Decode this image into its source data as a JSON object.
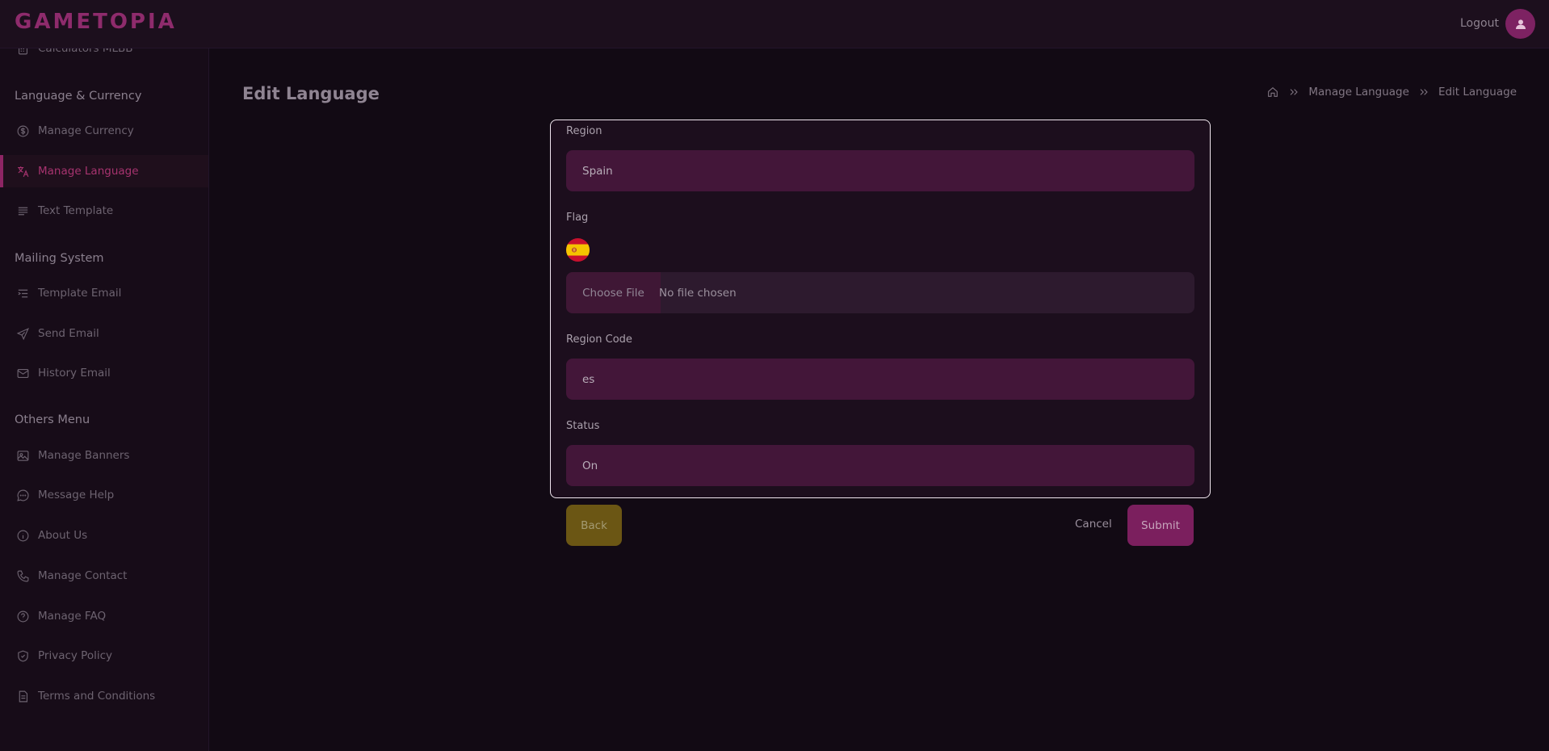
{
  "brand": {
    "logo": "GAMETOPIA",
    "accent": "#8e2b6c"
  },
  "header": {
    "logout_label": "Logout",
    "avatar_icon": "user-icon"
  },
  "sidebar": {
    "partial_item": "Calculators MLBB",
    "sections": [
      {
        "title": "Language & Currency"
      },
      {
        "title": "Mailing System"
      },
      {
        "title": "Others Menu"
      }
    ],
    "items": [
      {
        "label": "Manage Currency",
        "icon": "currency-icon"
      },
      {
        "label": "Manage Language",
        "icon": "translate-icon",
        "active": true
      },
      {
        "label": "Text Template",
        "icon": "text-lines-icon"
      },
      {
        "label": "Template Email",
        "icon": "list-indent-icon"
      },
      {
        "label": "Send Email",
        "icon": "send-icon"
      },
      {
        "label": "History Email",
        "icon": "mail-icon"
      },
      {
        "label": "Manage Banners",
        "icon": "image-icon"
      },
      {
        "label": "Message Help",
        "icon": "chat-icon"
      },
      {
        "label": "About Us",
        "icon": "info-icon"
      },
      {
        "label": "Manage Contact",
        "icon": "phone-icon"
      },
      {
        "label": "Manage FAQ",
        "icon": "question-icon"
      },
      {
        "label": "Privacy Policy",
        "icon": "shield-icon"
      },
      {
        "label": "Terms and Conditions",
        "icon": "document-icon"
      }
    ]
  },
  "page": {
    "title": "Edit Language",
    "breadcrumb": [
      "Manage Language",
      "Edit Language"
    ]
  },
  "form": {
    "region": {
      "label": "Region",
      "value": "Spain"
    },
    "flag": {
      "label": "Flag",
      "choose_label": "Choose File",
      "file_status": "No file chosen"
    },
    "region_code": {
      "label": "Region Code",
      "value": "es"
    },
    "status": {
      "label": "Status",
      "value": "On"
    }
  },
  "actions": {
    "back": "Back",
    "cancel": "Cancel",
    "submit": "Submit"
  }
}
